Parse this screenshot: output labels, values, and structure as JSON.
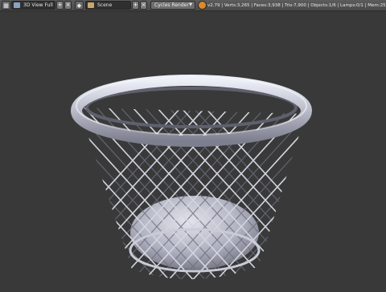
{
  "header": {
    "editor_type_label": "3D View Full",
    "scene_label": "Scene",
    "add_label": "+",
    "close_label": "×",
    "render_engine": "Cycles Render",
    "stats": "v2.79 | Verts:3,265 | Faces:3,938 | Tris:7,900 | Objects:1/6 | Lamps:0/1 | Mem:25.30M | Cylinder"
  },
  "icons": {
    "editor": "grid-icon",
    "scene": "scene-icon",
    "engine": "render-icon",
    "info": "blender-logo-icon"
  },
  "colors": {
    "background": "#393939",
    "topbar": "#4f4f4f",
    "mesh": "#c8cad6",
    "mesh_shadow": "#6f7080"
  }
}
